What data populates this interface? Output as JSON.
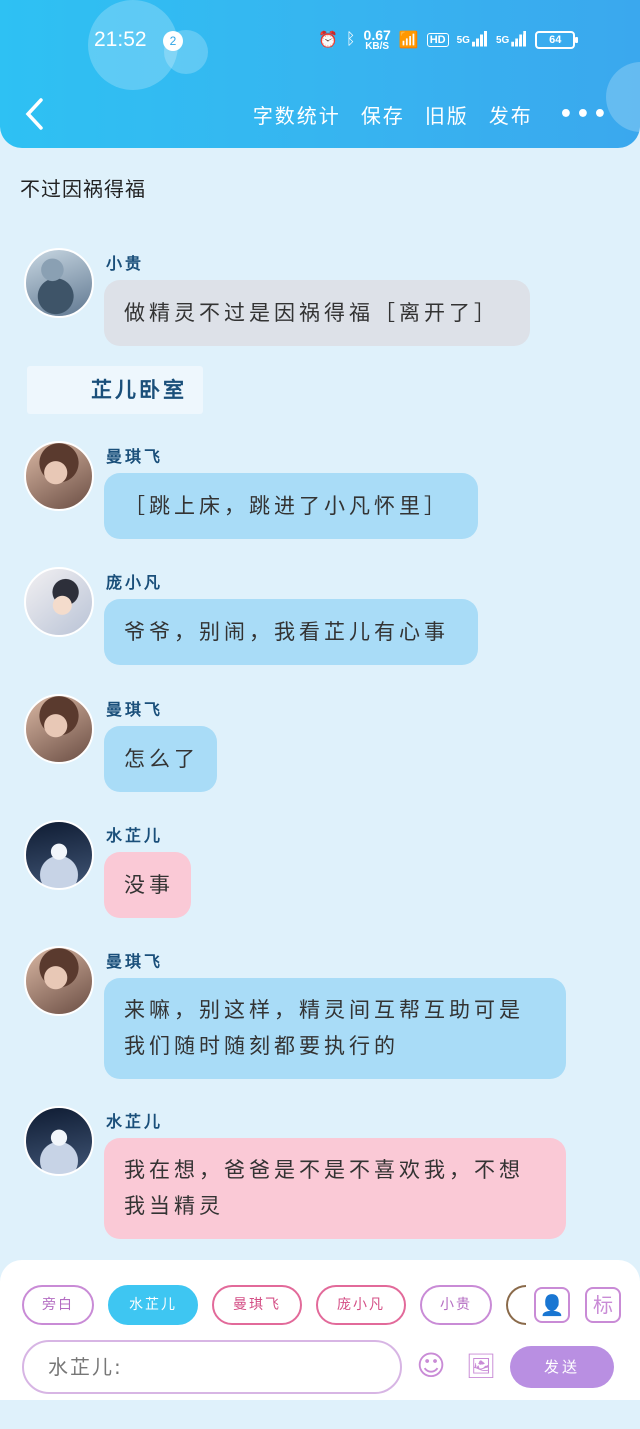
{
  "status": {
    "time": "21:52",
    "notifications": "2",
    "speed_value": "0.67",
    "speed_unit": "KB/S",
    "hd": "HD",
    "sig1": "5G",
    "sig2": "5G",
    "battery": "64"
  },
  "nav": {
    "back": "<",
    "links": [
      "字数统计",
      "保存",
      "旧版",
      "发布"
    ],
    "more": "•••"
  },
  "story_title": "不过因祸得福",
  "scene_label": "芷儿卧室",
  "messages": [
    {
      "name": "小贵",
      "text": "做精灵不过是因祸得福［离开了］"
    },
    {
      "name": "曼琪飞",
      "text": "［跳上床，跳进了小凡怀里］"
    },
    {
      "name": "庞小凡",
      "text": "爷爷，别闹，我看芷儿有心事"
    },
    {
      "name": "曼琪飞",
      "text": "怎么了"
    },
    {
      "name": "水芷儿",
      "text": "没事"
    },
    {
      "name": "曼琪飞",
      "line1": "来嘛，别这样，精灵间互帮互助可是",
      "line2": "我们随时随刻都要执行的"
    },
    {
      "name": "水芷儿",
      "line1": "我在想，爸爸是不是不喜欢我，不想",
      "line2": "我当精灵"
    }
  ],
  "chips": [
    "旁白",
    "水芷儿",
    "曼琪飞",
    "庞小凡",
    "小贵"
  ],
  "panel": {
    "avatar_btn": "👤",
    "tag_btn": "标",
    "input_value": "水芷儿:",
    "emoji": "☺",
    "image": "🖼",
    "send": "发送"
  },
  "colors": {
    "header": "#37b4f0",
    "bubble_gray": "#dde1e8",
    "bubble_blue": "#a9dcf7",
    "bubble_pink": "#fac9d6",
    "accent_purple": "#b98fe2"
  }
}
